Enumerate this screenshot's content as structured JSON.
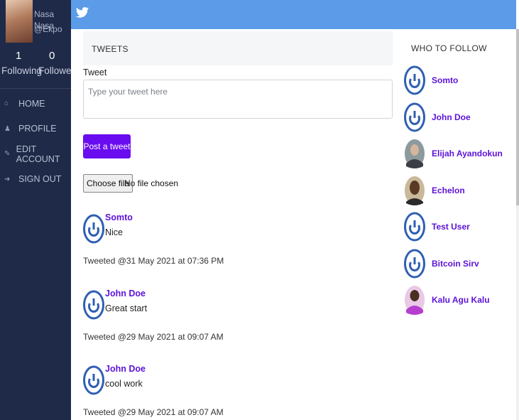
{
  "user": {
    "name": "Nasa Nasa",
    "handle": "@Ekpo",
    "following_count": "1",
    "following_label": "Following",
    "followers_count": "0",
    "followers_label": "Followers"
  },
  "nav": [
    {
      "label": "HOME",
      "icon": "home-icon"
    },
    {
      "label": "PROFILE",
      "icon": "user-icon"
    },
    {
      "label": "EDIT ACCOUNT",
      "icon": "edit-icon"
    },
    {
      "label": "SIGN OUT",
      "icon": "sign-out-icon"
    }
  ],
  "main": {
    "section_title": "TWEETS",
    "tweet_label": "Tweet",
    "tweet_placeholder": "Type your tweet here",
    "post_button": "Post a tweet",
    "file_button": "Choose file",
    "file_status": "No file chosen"
  },
  "feed": [
    {
      "user": "Somto",
      "text": "Nice",
      "time": "Tweeted @31 May 2021 at 07:36 PM"
    },
    {
      "user": "John Doe",
      "text": "Great start",
      "time": "Tweeted @29 May 2021 at 09:07 AM"
    },
    {
      "user": "John Doe",
      "text": "cool work",
      "time": "Tweeted @29 May 2021 at 09:07 AM"
    }
  ],
  "who_to_follow": {
    "title": "WHO TO FOLLOW",
    "users": [
      {
        "name": "Somto",
        "avatar": "default-avatar-icon"
      },
      {
        "name": "John Doe",
        "avatar": "default-avatar-icon"
      },
      {
        "name": "Elijah Ayandokun",
        "avatar": "photo-avatar"
      },
      {
        "name": "Echelon",
        "avatar": "photo-avatar"
      },
      {
        "name": "Test User",
        "avatar": "default-avatar-icon"
      },
      {
        "name": "Bitcoin Sirv",
        "avatar": "default-avatar-icon"
      },
      {
        "name": "Kalu Agu Kalu",
        "avatar": "photo-avatar"
      }
    ]
  },
  "colors": {
    "sidebar": "#1f2a48",
    "topbar": "#5b9be8",
    "accent": "#6a0cf0",
    "link": "#5c12d8"
  }
}
